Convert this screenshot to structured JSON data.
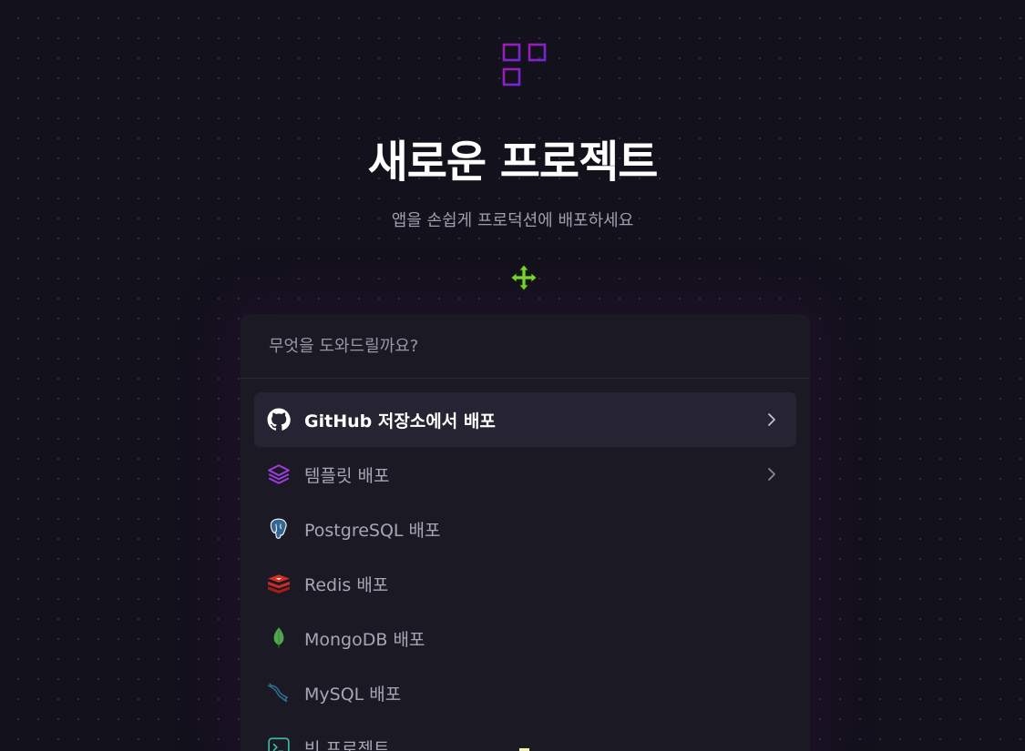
{
  "header": {
    "title": "새로운 프로젝트",
    "subtitle": "앱을 손쉽게 프로덕션에 배포하세요"
  },
  "search": {
    "placeholder": "무엇을 도와드릴까요?"
  },
  "menu": {
    "items": [
      {
        "label": "GitHub 저장소에서 배포",
        "icon": "github-icon",
        "has_chevron": true,
        "active": true
      },
      {
        "label": "템플릿 배포",
        "icon": "layers-icon",
        "has_chevron": true
      },
      {
        "label": "PostgreSQL 배포",
        "icon": "postgresql-icon",
        "has_chevron": false
      },
      {
        "label": "Redis 배포",
        "icon": "redis-icon",
        "has_chevron": false
      },
      {
        "label": "MongoDB 배포",
        "icon": "mongodb-icon",
        "has_chevron": false
      },
      {
        "label": "MySQL 배포",
        "icon": "mysql-icon",
        "has_chevron": false
      },
      {
        "label": "빈 프로젝트",
        "icon": "terminal-icon",
        "has_chevron": false
      }
    ]
  },
  "colors": {
    "background": "#13111c",
    "panel": "#1b1924",
    "accent_purple": "#8a1fc4",
    "cursor_green": "#7cdc2a"
  }
}
